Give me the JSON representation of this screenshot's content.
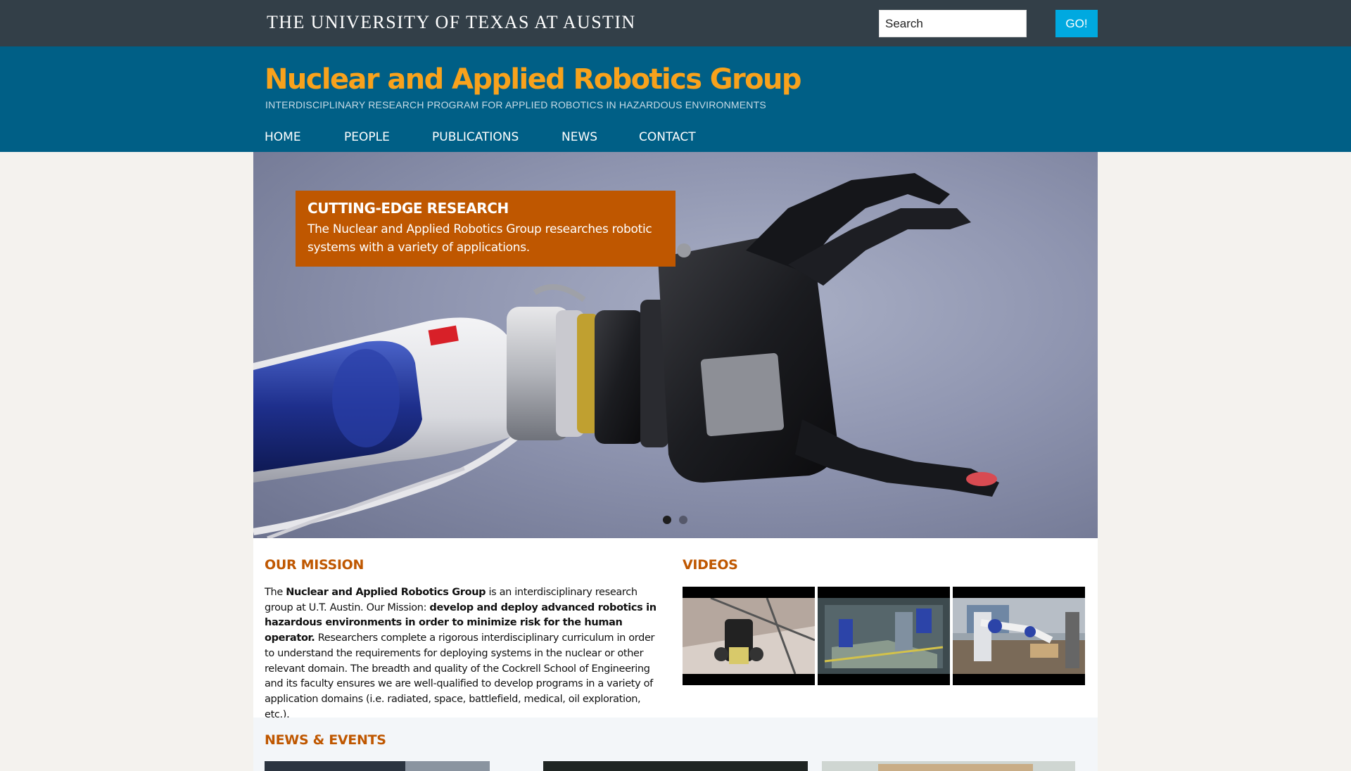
{
  "topbar": {
    "university": "THE UNIVERSITY OF TEXAS AT AUSTIN",
    "search": {
      "value": "",
      "placeholder": "Search"
    },
    "go_label": "GO!"
  },
  "header": {
    "title": "Nuclear and Applied Robotics Group",
    "subtitle": "INTERDISCIPLINARY RESEARCH PROGRAM FOR APPLIED ROBOTICS IN HAZARDOUS ENVIRONMENTS"
  },
  "nav": {
    "items": [
      {
        "label": "HOME"
      },
      {
        "label": "PEOPLE"
      },
      {
        "label": "PUBLICATIONS"
      },
      {
        "label": "NEWS"
      },
      {
        "label": "CONTACT"
      }
    ]
  },
  "hero": {
    "caption_title": "CUTTING-EDGE RESEARCH",
    "caption_text": "The Nuclear and Applied Robotics Group researches robotic systems with a variety of applications.",
    "slide_count": 2,
    "active_slide": 1
  },
  "mission": {
    "title": "OUR MISSION",
    "p1": "The ",
    "p2": "Nuclear and Applied Robotics Group",
    "p3": " is an interdisciplinary research group at U.T. Austin. Our Mission: ",
    "p4": "develop and deploy advanced robotics in hazardous environments in order to minimize risk for the human operator.",
    "p5": " Researchers complete a rigorous interdisciplinary curriculum in order to understand the requirements for deploying systems in the nuclear or other relevant domain.  The breadth and quality of the Cockrell School of Engineering and its faculty ensures we are well-qualified to develop programs in a variety of application domains (i.e. radiated, space, battlefield, medical, oil exploration, etc.)."
  },
  "videos": {
    "title": "VIDEOS",
    "items": [
      {
        "icon": "video-thumbnail-mobile-robot"
      },
      {
        "icon": "video-thumbnail-glovebox-robot"
      },
      {
        "icon": "video-thumbnail-lab-arm"
      }
    ]
  },
  "news": {
    "title": "NEWS & EVENTS"
  },
  "colors": {
    "topbar": "#333f48",
    "header": "#005f86",
    "title": "#f8a21c",
    "burnt_orange": "#bf5700",
    "go_button": "#00a9e0"
  }
}
